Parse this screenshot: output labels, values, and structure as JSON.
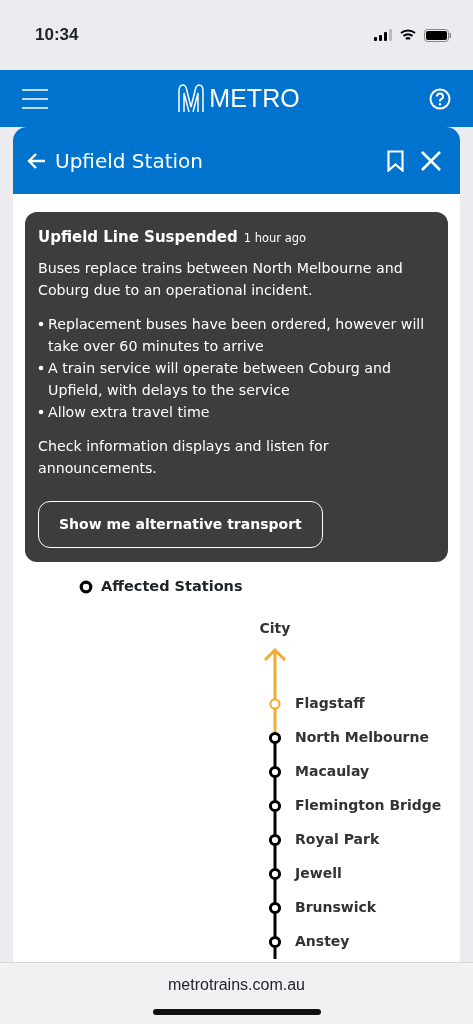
{
  "status_bar": {
    "time": "10:34"
  },
  "header": {
    "brand": "METRO"
  },
  "panel": {
    "title": "Upfield Station"
  },
  "alert": {
    "title": "Upfield Line Suspended",
    "time": "1 hour ago",
    "intro": "Buses replace trains between North Melbourne and Coburg due to an operational incident.",
    "bullets": [
      "Replacement buses have been ordered, however will take over 60 minutes to arrive",
      "A train service will operate between Coburg and Upfield, with delays to the service",
      "Allow extra travel time"
    ],
    "outro": "Check information displays and listen for announcements.",
    "button": "Show me alternative transport"
  },
  "legend": {
    "label": "Affected Stations"
  },
  "line": {
    "direction": "City",
    "stations": [
      {
        "name": "Flagstaff",
        "affected": false
      },
      {
        "name": "North Melbourne",
        "affected": true
      },
      {
        "name": "Macaulay",
        "affected": true
      },
      {
        "name": "Flemington Bridge",
        "affected": true
      },
      {
        "name": "Royal Park",
        "affected": true
      },
      {
        "name": "Jewell",
        "affected": true
      },
      {
        "name": "Brunswick",
        "affected": true
      },
      {
        "name": "Anstey",
        "affected": true
      }
    ]
  },
  "browser": {
    "url": "metrotrains.com.au"
  }
}
